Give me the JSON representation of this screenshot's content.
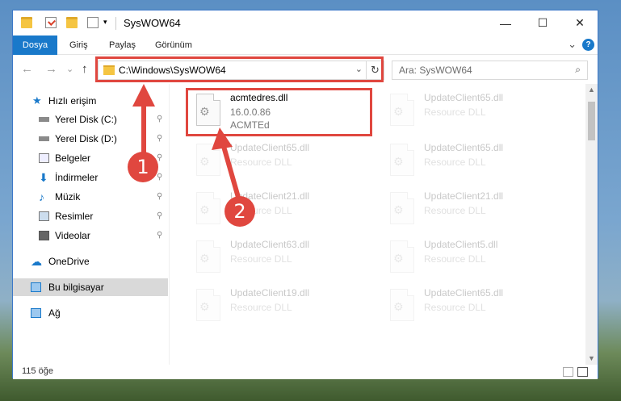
{
  "window": {
    "title": "SysWOW64",
    "controls": {
      "minimize": "—",
      "maximize": "☐",
      "close": "✕"
    }
  },
  "ribbon": {
    "tabs": [
      "Dosya",
      "Giriş",
      "Paylaş",
      "Görünüm"
    ],
    "collapse_glyph": "⌄",
    "help_glyph": "?"
  },
  "nav": {
    "back": "←",
    "forward": "→",
    "recent": "⌄",
    "up": "↑",
    "address": "C:\\Windows\\SysWOW64",
    "address_chevron": "⌄",
    "refresh": "↻",
    "search_placeholder": "Ara: SysWOW64",
    "search_icon": "⌕"
  },
  "sidebar": {
    "items": [
      {
        "label": "Hızlı erişim",
        "icon": "star-icon",
        "pinned": false
      },
      {
        "label": "Yerel Disk (C:)",
        "icon": "drive-icon",
        "pinned": true
      },
      {
        "label": "Yerel Disk (D:)",
        "icon": "drive-icon",
        "pinned": true
      },
      {
        "label": "Belgeler",
        "icon": "documents-icon",
        "pinned": true
      },
      {
        "label": "İndirmeler",
        "icon": "download-icon",
        "pinned": true
      },
      {
        "label": "Müzik",
        "icon": "music-icon",
        "pinned": true
      },
      {
        "label": "Resimler",
        "icon": "pictures-icon",
        "pinned": true
      },
      {
        "label": "Videolar",
        "icon": "videos-icon",
        "pinned": true
      },
      {
        "label": "OneDrive",
        "icon": "cloud-icon",
        "pinned": false
      },
      {
        "label": "Bu bilgisayar",
        "icon": "computer-icon",
        "pinned": false,
        "selected": true
      },
      {
        "label": "Ağ",
        "icon": "network-icon",
        "pinned": false
      }
    ],
    "pin_glyph": "📌"
  },
  "files": [
    {
      "name": "acmtedres.dll",
      "line2": "16.0.0.86",
      "line3": "ACMTEd",
      "highlighted": true
    },
    {
      "name": "UpdateClient65.dll",
      "line2": "Resource DLL",
      "highlighted": false
    },
    {
      "name": "UpdateClient65.dll",
      "line2": "Resource DLL",
      "highlighted": false
    },
    {
      "name": "UpdateClient65.dll",
      "line2": "Resource DLL",
      "highlighted": false
    },
    {
      "name": "UpdateClient21.dll",
      "line2": "Resource DLL",
      "highlighted": false
    },
    {
      "name": "UpdateClient21.dll",
      "line2": "Resource DLL",
      "highlighted": false
    },
    {
      "name": "UpdateClient63.dll",
      "line2": "Resource DLL",
      "highlighted": false
    },
    {
      "name": "UpdateClient5.dll",
      "line2": "Resource DLL",
      "highlighted": false
    },
    {
      "name": "UpdateClient19.dll",
      "line2": "Resource DLL",
      "highlighted": false
    },
    {
      "name": "UpdateClient65.dll",
      "line2": "Resource DLL",
      "highlighted": false
    }
  ],
  "status": {
    "item_count": "115 öğe"
  },
  "annotations": {
    "step1": "1",
    "step2": "2",
    "color": "#e0473f"
  },
  "colors": {
    "accent": "#1979ca",
    "highlight": "#e0473f"
  }
}
